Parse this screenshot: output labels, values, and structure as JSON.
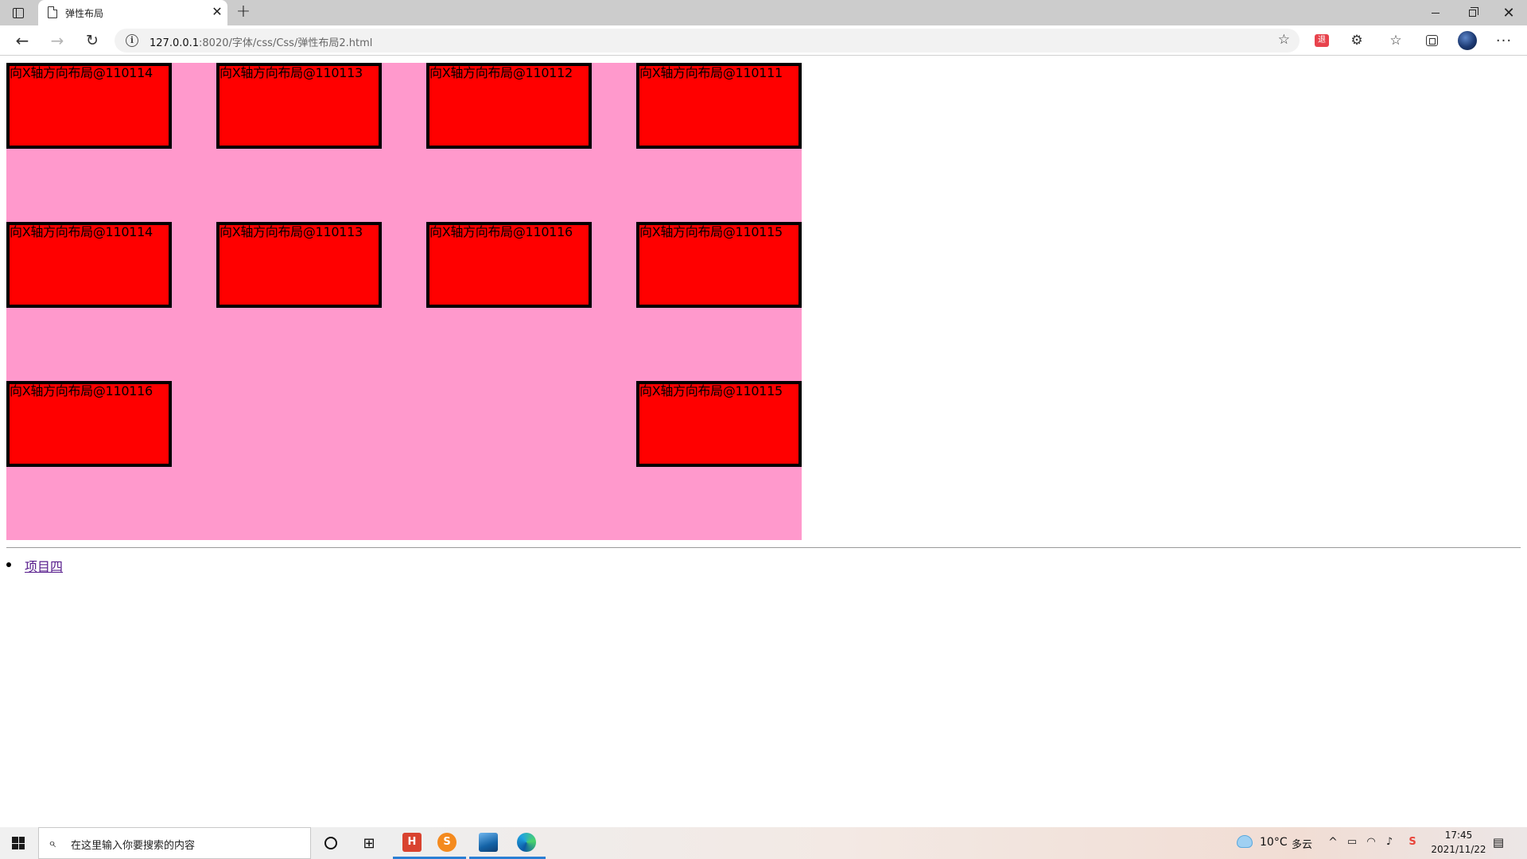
{
  "browser": {
    "tab_title": "弹性布局",
    "tab_close": "✕",
    "new_tab": "+",
    "url_host": "127.0.0.1",
    "url_path": ":8020/字体/css/Css/弹性布局2.html",
    "back": "←",
    "forward": "→",
    "reload": "↻",
    "info": "i",
    "fav_add": "☆",
    "ext_label": "退",
    "extensions": "⚙",
    "favorites": "☆",
    "menu": "···",
    "close": "✕"
  },
  "page": {
    "boxes": [
      {
        "label": "向X轴方向布局@110114"
      },
      {
        "label": "向X轴方向布局@110113"
      },
      {
        "label": "向X轴方向布局@110112"
      },
      {
        "label": "向X轴方向布局@110111"
      },
      {
        "label": "向X轴方向布局@110114"
      },
      {
        "label": "向X轴方向布局@110113"
      },
      {
        "label": "向X轴方向布局@110116"
      },
      {
        "label": "向X轴方向布局@110115"
      },
      {
        "label": "向X轴方向布局@110116"
      },
      {
        "label": "向X轴方向布局@110115"
      }
    ],
    "list_items": [
      {
        "label": "项目四"
      }
    ],
    "colors": {
      "container_bg": "#ff99cc",
      "box_bg": "#ff0000",
      "box_border": "#000000",
      "link": "#551a8b"
    }
  },
  "taskbar": {
    "search_placeholder": "在这里输入你要搜索的内容",
    "search_icon": "⌕",
    "task_view": "⊞",
    "hbuilder_label": "H",
    "orange_label": "S",
    "weather_temp": "10°C",
    "weather_cond": "多云",
    "tray_chevron": "^",
    "tray_battery": "▭",
    "tray_network": "◠",
    "tray_volume": "♪",
    "tray_ime": "S",
    "time": "17:45",
    "date": "2021/11/22",
    "notification": "▤"
  }
}
